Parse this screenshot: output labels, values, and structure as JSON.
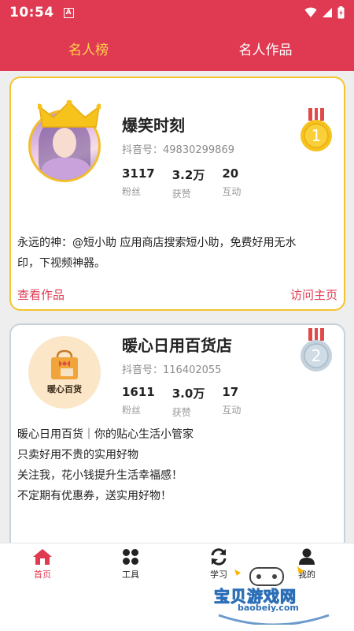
{
  "status_bar": {
    "time": "10:54",
    "notification_glyph": "A"
  },
  "tabs": [
    {
      "label": "名人榜",
      "active": true
    },
    {
      "label": "名人作品",
      "active": false
    }
  ],
  "colors": {
    "accent": "#e03a52",
    "gold": "#f5c432",
    "silver": "#c7d2da",
    "active_tab": "#ffd24d"
  },
  "cards": [
    {
      "rank": "1",
      "name": "爆笑时刻",
      "douyin_id": "抖音号：49830299869",
      "stats": [
        {
          "value": "3117",
          "label": "粉丝"
        },
        {
          "value": "3.2万",
          "label": "获赞"
        },
        {
          "value": "20",
          "label": "互动"
        }
      ],
      "description_lines": [
        "永远的神：@短小助 应用商店搜索短小助，免费好用无水",
        "印，下视频神器。"
      ],
      "view_works": "查看作品",
      "visit_home": "访问主页"
    },
    {
      "rank": "2",
      "name": "暖心日用百货店",
      "douyin_id": "抖音号：116402055",
      "avatar_text": "暖心百货",
      "stats": [
        {
          "value": "1611",
          "label": "粉丝"
        },
        {
          "value": "3.0万",
          "label": "获赞"
        },
        {
          "value": "17",
          "label": "互动"
        }
      ],
      "description_lines": [
        "暖心日用百货｜你的贴心生活小管家",
        "只卖好用不贵的实用好物",
        "关注我，花小钱提升生活幸福感！",
        "不定期有优惠券，送实用好物！"
      ]
    }
  ],
  "bottom_nav": [
    {
      "label": "首页",
      "icon": "home-icon",
      "active": true
    },
    {
      "label": "工具",
      "icon": "grid-icon",
      "active": false
    },
    {
      "label": "学习",
      "icon": "refresh-icon",
      "active": false
    },
    {
      "label": "我的",
      "icon": "user-icon",
      "active": false
    }
  ],
  "watermark": {
    "text": "宝贝游戏网",
    "url": "baobeiy.com"
  }
}
